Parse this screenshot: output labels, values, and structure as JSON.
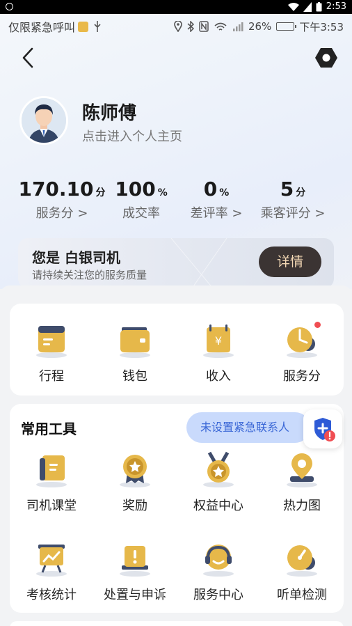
{
  "system_bar": {
    "time": "2:53"
  },
  "phone_status": {
    "carrier_text": "仅限紧急呼叫",
    "battery": "26%",
    "time": "下午3:53"
  },
  "header": {
    "driver_name": "陈师傅",
    "profile_link": "点击进入个人主页"
  },
  "stats": [
    {
      "value": "170.10",
      "unit": "分",
      "label": "服务分 >"
    },
    {
      "value": "100",
      "unit": "%",
      "label": "成交率"
    },
    {
      "value": "0",
      "unit": "%",
      "label": "差评率 >"
    },
    {
      "value": "5",
      "unit": "分",
      "label": "乘客评分 >"
    }
  ],
  "level_card": {
    "title": "您是 白银司机",
    "subtitle": "请持续关注您的服务质量",
    "button": "详情"
  },
  "quick_links": [
    {
      "label": "行程",
      "icon": "itinerary-icon"
    },
    {
      "label": "钱包",
      "icon": "wallet-icon"
    },
    {
      "label": "收入",
      "icon": "income-icon"
    },
    {
      "label": "服务分",
      "icon": "service-score-icon",
      "badge": true
    }
  ],
  "tools": {
    "title": "常用工具",
    "emergency_contact": "未设置紧急联系人",
    "items": [
      {
        "label": "司机课堂",
        "icon": "book-icon"
      },
      {
        "label": "奖励",
        "icon": "medal-icon"
      },
      {
        "label": "权益中心",
        "icon": "badge-icon"
      },
      {
        "label": "热力图",
        "icon": "map-pin-icon"
      },
      {
        "label": "考核统计",
        "icon": "chart-board-icon"
      },
      {
        "label": "处置与申诉",
        "icon": "alert-box-icon"
      },
      {
        "label": "服务中心",
        "icon": "headset-icon"
      },
      {
        "label": "听单检测",
        "icon": "gauge-icon"
      }
    ]
  },
  "colors": {
    "gold": "#e6b84a",
    "gold_dark": "#c9952c",
    "slate": "#3f4c6b",
    "detail_button_bg": "#3b3433",
    "detail_button_text": "#f3d8b5",
    "emergency_pill_bg": "#c9dafc",
    "emergency_pill_text": "#3a67d6",
    "alert_red": "#f04d52"
  }
}
